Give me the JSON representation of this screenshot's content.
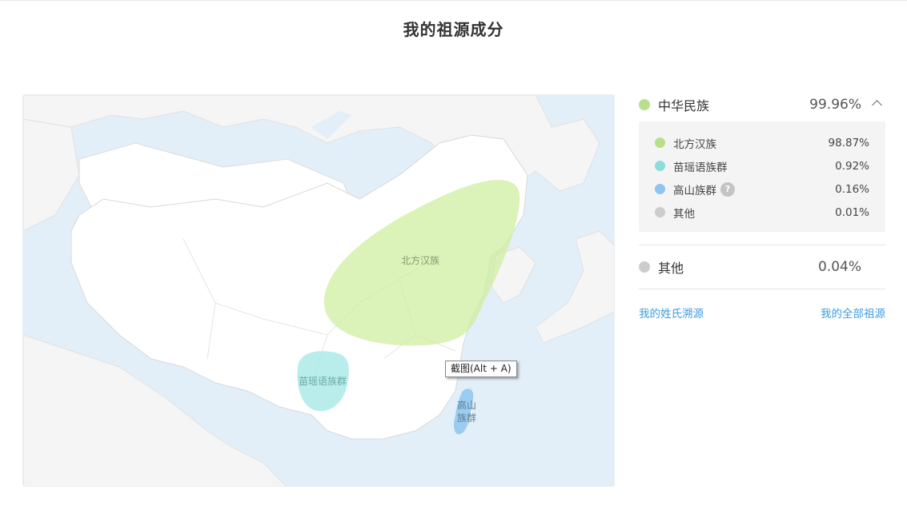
{
  "page": {
    "title": "我的祖源成分"
  },
  "map": {
    "regions": [
      {
        "label": "北方汉族",
        "color": "#cfeda0"
      },
      {
        "label": "苗瑶语族群",
        "color": "#a7e8e6"
      },
      {
        "label_line1": "高山",
        "label_line2": "族群",
        "color": "#8fc8f0"
      }
    ],
    "tooltip": "截图(Alt + A)"
  },
  "groups": [
    {
      "name": "中华民族",
      "percent": "99.96%",
      "color": "#b8e08a",
      "expanded": true,
      "children": [
        {
          "name": "北方汉族",
          "percent": "98.87%",
          "color": "#b8e08a"
        },
        {
          "name": "苗瑶语族群",
          "percent": "0.92%",
          "color": "#8edcdc"
        },
        {
          "name": "高山族群",
          "percent": "0.16%",
          "color": "#8cc6ee",
          "help": "?"
        },
        {
          "name": "其他",
          "percent": "0.01%",
          "color": "#cccccc"
        }
      ]
    },
    {
      "name": "其他",
      "percent": "0.04%",
      "color": "#cccccc"
    }
  ],
  "links": {
    "surname": "我的姓氏溯源",
    "all": "我的全部祖源"
  }
}
